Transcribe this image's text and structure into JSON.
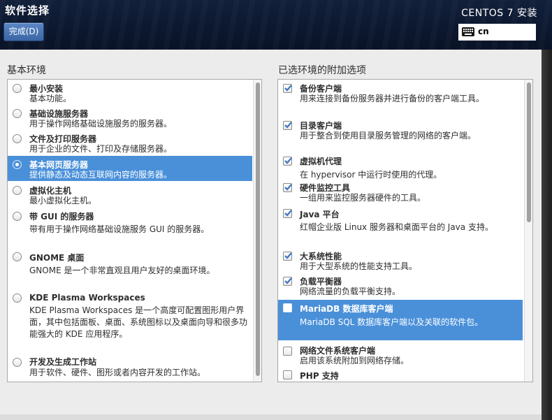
{
  "header": {
    "title": "软件选择",
    "done_label": "完成(D)",
    "product": "CENTOS 7 安装",
    "keyboard_layout": "cn"
  },
  "environments": {
    "title": "基本环境",
    "selected_index": 3,
    "items": [
      {
        "title": "最小安装",
        "desc": "基本功能。"
      },
      {
        "title": "基础设施服务器",
        "desc": "用于操作网络基础设施服务的服务器。"
      },
      {
        "title": "文件及打印服务器",
        "desc": "用于企业的文件、打印及存储服务器。"
      },
      {
        "title": "基本网页服务器",
        "desc": "提供静态及动态互联网内容的服务器。"
      },
      {
        "title": "虚拟化主机",
        "desc": "最小虚拟化主机。"
      },
      {
        "title": "带 GUI 的服务器",
        "desc": "带有用于操作网络基础设施服务 GUI 的服务器。"
      },
      {
        "title": "GNOME 桌面",
        "desc": "GNOME 是一个非常直观且用户友好的桌面环境。"
      },
      {
        "title": "KDE Plasma Workspaces",
        "desc": "KDE Plasma Workspaces 是一个高度可配置图形用户界面，其中包括面板、桌面、系统图标以及桌面向导和很多功能强大的 KDE 应用程序。"
      },
      {
        "title": "开发及生成工作站",
        "desc": "用于软件、硬件、图形或者内容开发的工作站。"
      }
    ]
  },
  "addons": {
    "title": "已选环境的附加选项",
    "items": [
      {
        "title": "备份客户端",
        "desc": "用来连接到备份服务器并进行备份的客户端工具。",
        "checked": true
      },
      {
        "title": "目录客户端",
        "desc": "用于整合到使用目录服务管理的网络的客户端。",
        "checked": true
      },
      {
        "title": "虚拟机代理",
        "desc": "在 hypervisor 中运行时使用的代理。",
        "checked": true
      },
      {
        "title": "硬件监控工具",
        "desc": "一组用来监控服务器硬件的工具。",
        "checked": true
      },
      {
        "title": "Java 平台",
        "desc": "红帽企业版 Linux 服务器和桌面平台的 Java 支持。",
        "checked": true
      },
      {
        "title": "大系统性能",
        "desc": "用于大型系统的性能支持工具。",
        "checked": true
      },
      {
        "title": "负载平衡器",
        "desc": "网络流量的负载平衡支持。",
        "checked": true
      },
      {
        "title": "MariaDB 数据库客户端",
        "desc": "MariaDB SQL 数据库客户端以及关联的软件包。",
        "checked": false
      },
      {
        "title": "网络文件系统客户端",
        "desc": "启用该系统附加到网络存储。",
        "checked": false
      },
      {
        "title": "PHP 支持",
        "desc": "",
        "checked": false
      }
    ]
  }
}
